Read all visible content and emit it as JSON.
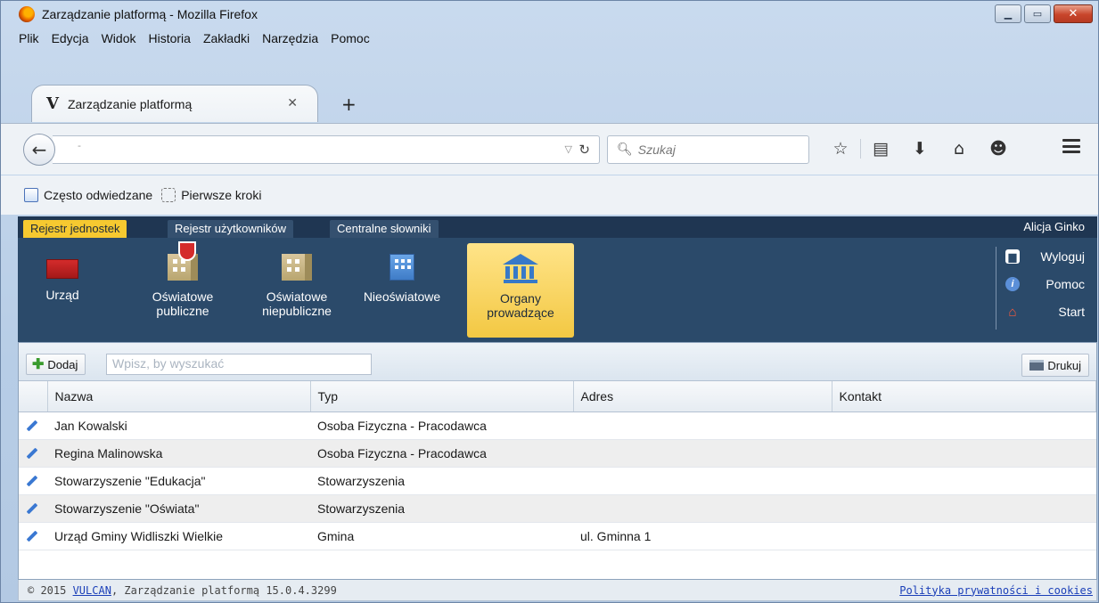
{
  "browser": {
    "title": "Zarządzanie platformą - Mozilla Firefox",
    "menu": [
      "Plik",
      "Edycja",
      "Widok",
      "Historia",
      "Zakładki",
      "Narzędzia",
      "Pomoc"
    ],
    "tab_title": "Zarządzanie platformą",
    "tab_icon": "V",
    "url": "-",
    "search_placeholder": "Szukaj",
    "bookmarks": [
      "Często odwiedzane",
      "Pierwsze kroki"
    ]
  },
  "app": {
    "tabs": [
      "Rejestr jednostek",
      "Rejestr użytkowników",
      "Centralne słowniki"
    ],
    "active_tab": "Rejestr jednostek",
    "user": "Alicja Ginko",
    "tools": [
      {
        "label": "Urząd",
        "icon": "office-seal-icon"
      },
      {
        "label": "Oświatowe publiczne",
        "icon": "public-school-icon"
      },
      {
        "label": "Oświatowe niepubliczne",
        "icon": "private-school-icon"
      },
      {
        "label": "Nieoświatowe",
        "icon": "office-building-icon"
      },
      {
        "label": "Organy prowadzące",
        "icon": "institution-icon"
      }
    ],
    "active_tool": "Organy prowadzące",
    "side_links": [
      {
        "label": "Wyloguj",
        "icon": "lock-icon"
      },
      {
        "label": "Pomoc",
        "icon": "info-icon"
      },
      {
        "label": "Start",
        "icon": "home-icon"
      }
    ],
    "toolbar": {
      "add_label": "Dodaj",
      "search_placeholder": "Wpisz, by wyszukać",
      "print_label": "Drukuj"
    },
    "table": {
      "columns": [
        "Nazwa",
        "Typ",
        "Adres",
        "Kontakt"
      ],
      "rows": [
        [
          "Jan Kowalski",
          "Osoba Fizyczna - Pracodawca",
          "",
          ""
        ],
        [
          "Regina Malinowska",
          "Osoba Fizyczna - Pracodawca",
          "",
          ""
        ],
        [
          "Stowarzyszenie \"Edukacja\"",
          "Stowarzyszenia",
          "",
          ""
        ],
        [
          "Stowarzyszenie \"Oświata\"",
          "Stowarzyszenia",
          "",
          ""
        ],
        [
          "Urząd Gminy Widliszki Wielkie",
          "Gmina",
          "ul. Gminna 1",
          ""
        ]
      ]
    },
    "footer": {
      "prefix": "© 2015 ",
      "vendor": "VULCAN",
      "suffix": ", Zarządzanie platformą 15.0.4.3299",
      "privacy": "Polityka prywatności i cookies"
    }
  }
}
